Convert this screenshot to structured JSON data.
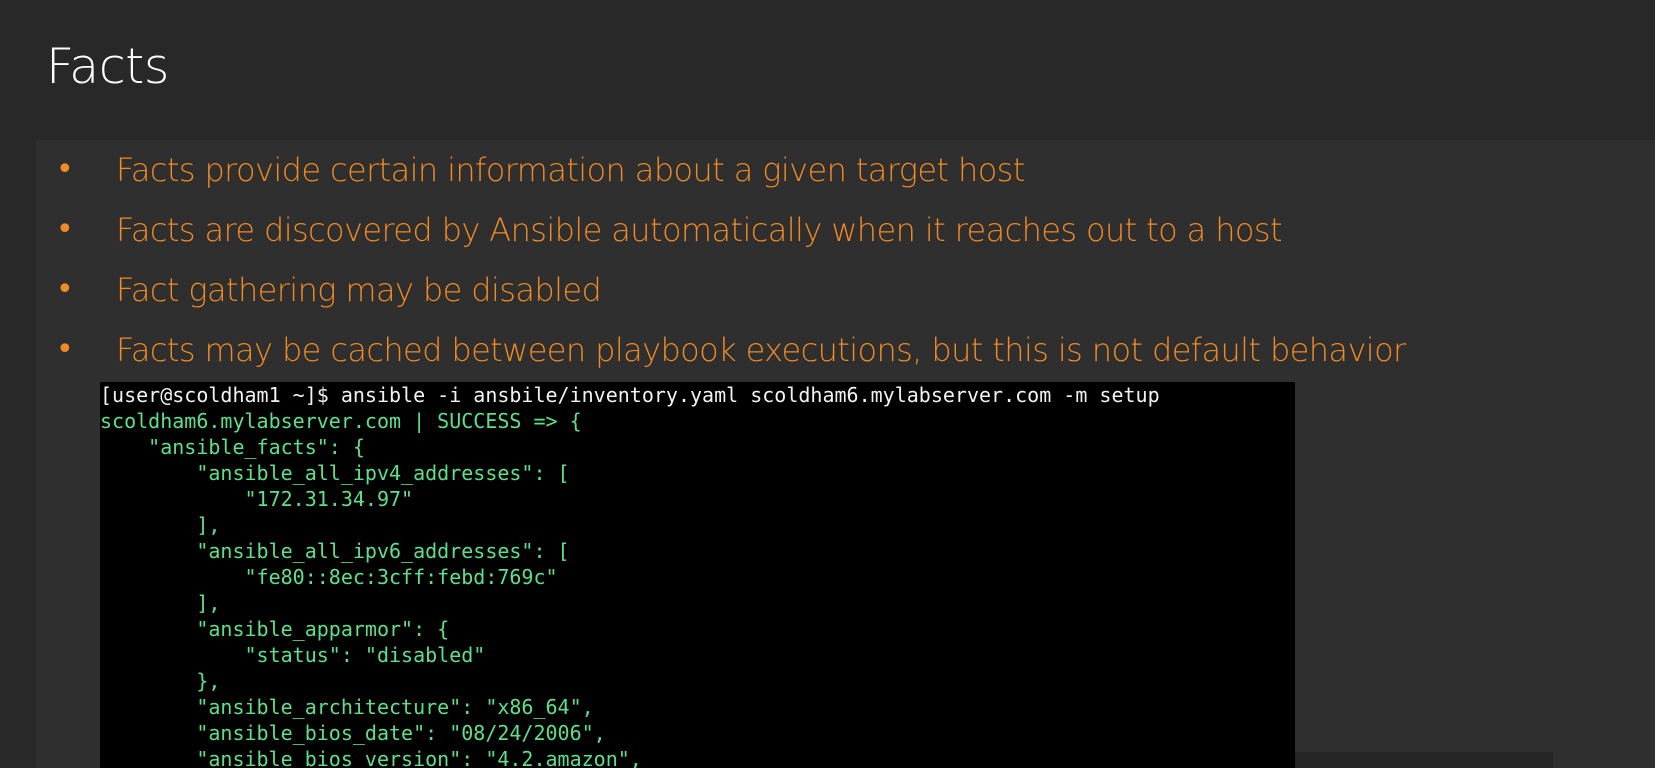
{
  "slide": {
    "title": "Facts"
  },
  "bullets": [
    "Facts provide certain information about a given target host",
    "Facts are discovered by Ansible automatically when it reaches out to a host",
    "Fact gathering may be disabled",
    "Facts may be cached between playbook executions, but this is not default behavior"
  ],
  "terminal": {
    "lines": [
      "[user@scoldham1 ~]$ ansible -i ansbile/inventory.yaml scoldham6.mylabserver.com -m setup",
      "scoldham6.mylabserver.com | SUCCESS => {",
      "    \"ansible_facts\": {",
      "        \"ansible_all_ipv4_addresses\": [",
      "            \"172.31.34.97\"",
      "        ],",
      "        \"ansible_all_ipv6_addresses\": [",
      "            \"fe80::8ec:3cff:febd:769c\"",
      "        ],",
      "        \"ansible_apparmor\": {",
      "            \"status\": \"disabled\"",
      "        },",
      "        \"ansible_architecture\": \"x86_64\",",
      "        \"ansible_bios_date\": \"08/24/2006\",",
      "        \"ansible_bios_version\": \"4.2.amazon\","
    ]
  },
  "colors": {
    "background": "#282828",
    "panel": "#2f2f2f",
    "accent": "#f08a24",
    "terminal_bg": "#000000",
    "terminal_green": "#5ce08a",
    "terminal_cmd": "#f2f2f2"
  }
}
